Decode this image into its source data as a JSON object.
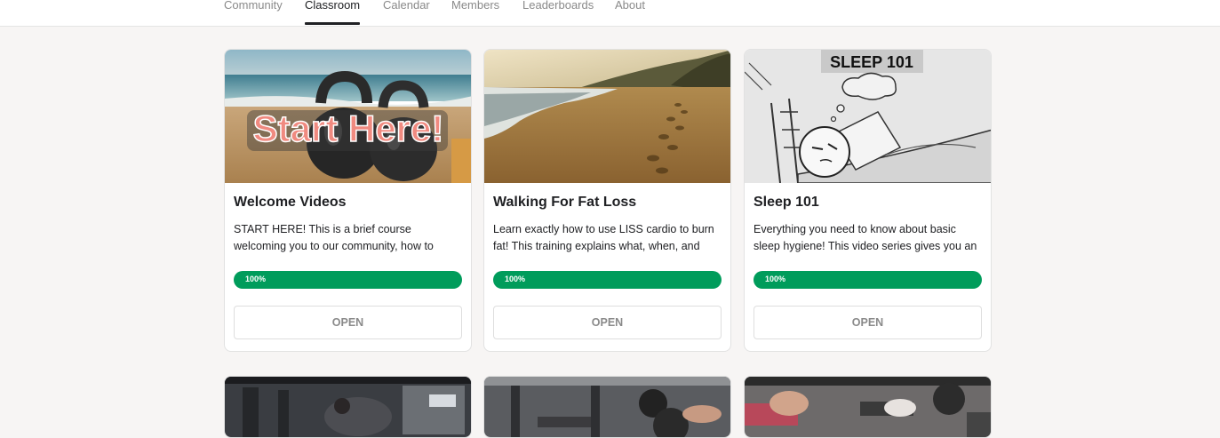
{
  "nav": {
    "tabs": [
      {
        "label": "Community"
      },
      {
        "label": "Classroom",
        "active": true
      },
      {
        "label": "Calendar"
      },
      {
        "label": "Members"
      },
      {
        "label": "Leaderboards"
      },
      {
        "label": "About"
      }
    ]
  },
  "courses": [
    {
      "title": "Welcome Videos",
      "description": "START HERE! This is a brief course welcoming you to our community, how to",
      "progress": "100%",
      "progress_value": 1.0,
      "button": "OPEN",
      "thumbnail_text": "Start Here!",
      "thumbnail_icon": "kettlebells-on-beach"
    },
    {
      "title": "Walking For Fat Loss",
      "description": "Learn exactly how to use LISS cardio to burn fat! This training explains what, when, and",
      "progress": "100%",
      "progress_value": 1.0,
      "button": "OPEN",
      "thumbnail_icon": "footprints-on-beach"
    },
    {
      "title": "Sleep 101",
      "description": "Everything you need to know about basic sleep hygiene! This video series gives you an",
      "progress": "100%",
      "progress_value": 1.0,
      "button": "OPEN",
      "thumbnail_text": "SLEEP 101",
      "thumbnail_icon": "sleeping-cartoon"
    }
  ],
  "colors": {
    "progress": "#009c5b",
    "background": "#f7f5f4",
    "accent_text": "#202124",
    "start_here_text": "#f08a80"
  }
}
